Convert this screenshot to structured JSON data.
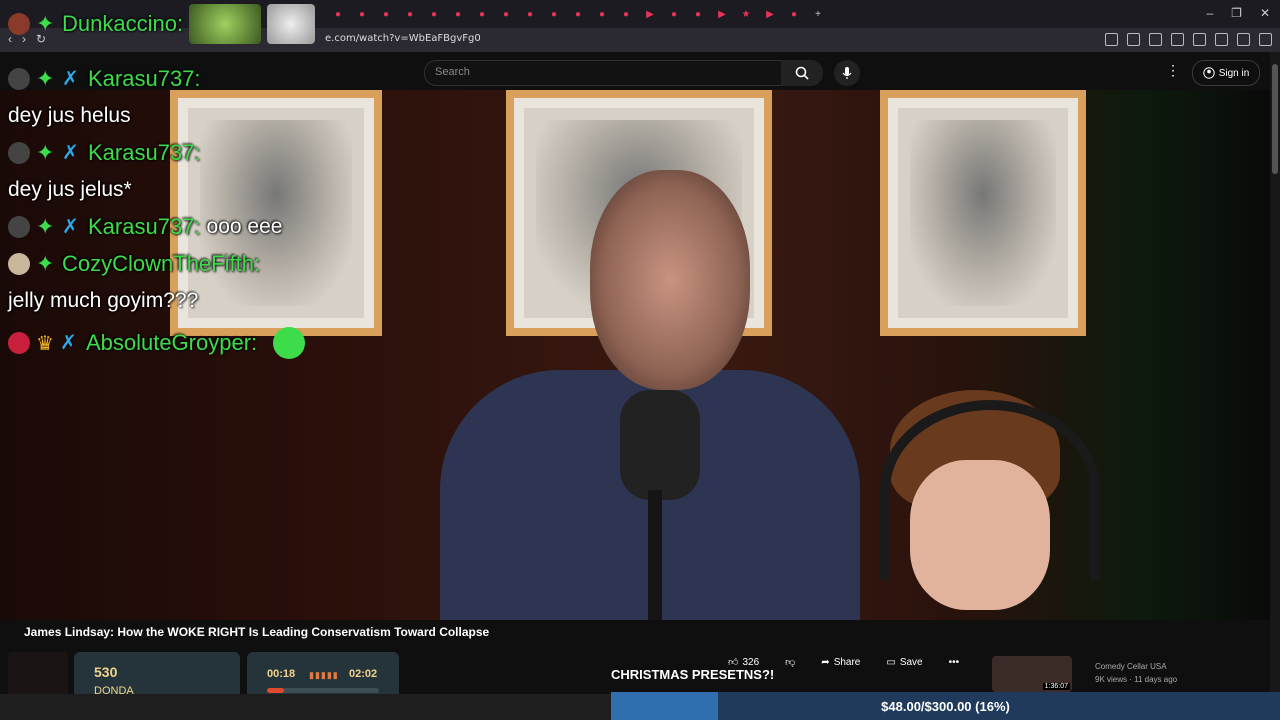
{
  "browser": {
    "url": "e.com/watch?v=WbEaFBgvFg0",
    "tab_icons": [
      "youtube-tab-icon",
      "youtube-tab-icon",
      "youtube-tab-icon",
      "youtube-tab-icon",
      "youtube-tab-icon",
      "youtube-tab-icon",
      "youtube-tab-icon",
      "youtube-tab-icon",
      "youtube-tab-icon",
      "youtube-tab-icon",
      "youtube-tab-icon",
      "youtube-tab-icon",
      "youtube-tab-icon",
      "play-tab-icon",
      "youtube-tab-icon",
      "youtube-tab-icon",
      "play-tab-icon",
      "star-tab-icon",
      "play-tab-icon",
      "discord-tab-icon"
    ],
    "new_tab": "+",
    "window_controls": [
      "–",
      "❐",
      "✕"
    ]
  },
  "youtube": {
    "search_placeholder": "Search",
    "sign_in": "Sign in",
    "video_title": "James Lindsay: How the WOKE RIGHT Is Leading Conservatism Toward Collapse",
    "likes": "326",
    "share": "Share",
    "save": "Save",
    "related": {
      "channel": "Comedy Cellar USA",
      "meta": "9K views · 11 days ago",
      "duration": "1:36:07"
    }
  },
  "chat": {
    "top_user": "Dunkaccino:",
    "messages": [
      {
        "user": "Karasu737:",
        "text": "dey jus helus"
      },
      {
        "user": "Karasu737:",
        "text": "dey jus jelus*"
      },
      {
        "user": "Karasu737:",
        "text": "ooo eee"
      },
      {
        "user": "CozyClownTheFifth:",
        "text": "jelly much goyim???"
      },
      {
        "user": "AbsoluteGroyper:",
        "text": ""
      }
    ]
  },
  "overlay": {
    "counter_value": "530",
    "counter_label": "DONDA",
    "time_elapsed": "00:18",
    "time_total": "02:02",
    "song_progress": 0.15,
    "banner": "CHRISTMAS PRESETNS?!",
    "goal_text": "$48.00/$300.00 (16%)",
    "goal_fraction": 0.16
  },
  "colors": {
    "chat_username": "#3ddc4a",
    "goal_fill": "#2f6fb0",
    "widget_bg": "#25343a",
    "widget_text": "#f2d38a"
  }
}
